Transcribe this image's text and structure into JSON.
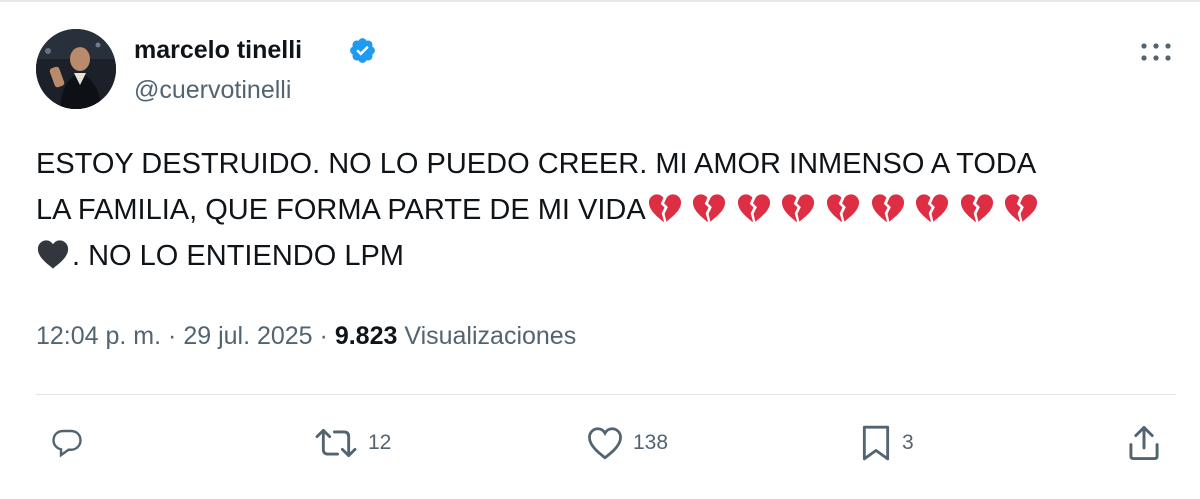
{
  "author": {
    "display_name": "marcelo tinelli",
    "handle": "@cuervotinelli",
    "verified": true
  },
  "tweet": {
    "text_line1": "ESTOY DESTRUIDO. NO LO PUEDO CREER. MI AMOR INMENSO A TODA",
    "text_line2": "LA FAMILIA, QUE FORMA PARTE DE MI VIDA",
    "broken_hearts": [
      "💔",
      "💔",
      "💔",
      "💔",
      "💔",
      "💔",
      "💔",
      "💔",
      "💔"
    ],
    "black_heart": "🖤",
    "text_line3": ". NO LO ENTIENDO LPM"
  },
  "meta": {
    "time": "12:04 p. m.",
    "separator": "·",
    "date": "29 jul. 2025",
    "views_count": "9.823",
    "views_label": "Visualizaciones"
  },
  "actions": {
    "reply": {
      "icon": "reply-icon",
      "count": ""
    },
    "retweet": {
      "icon": "retweet-icon",
      "count": "12"
    },
    "like": {
      "icon": "heart-outline-icon",
      "count": "138"
    },
    "bookmark": {
      "icon": "bookmark-icon",
      "count": "3"
    },
    "share": {
      "icon": "share-icon",
      "count": ""
    }
  },
  "colors": {
    "text_primary": "#0f1419",
    "text_secondary": "#536471",
    "verified_blue": "#1d9bf0",
    "broken_heart_red": "#dd2e44",
    "black_heart": "#31373d"
  }
}
